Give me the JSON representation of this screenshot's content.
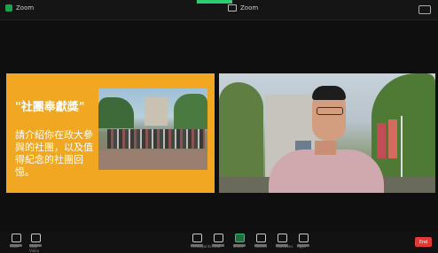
{
  "topbar": {
    "app_title": "Zoom",
    "window_label": "Zoom"
  },
  "slide": {
    "title": "\"社團奉獻獎\"",
    "body": "請介紹你在政大參與的社團，以及值得紀念的社團回憶。"
  },
  "toolbar": {
    "items": [
      {
        "label": "Mute"
      },
      {
        "label": "Stop Video"
      },
      {
        "label": "Participants"
      },
      {
        "label": "Chat"
      },
      {
        "label": "Share"
      },
      {
        "label": "Record"
      },
      {
        "label": "Reactions"
      },
      {
        "label": "Apps"
      }
    ],
    "end_label": "End"
  },
  "colors": {
    "slide_bg": "#f2a722",
    "end_button": "#e53935",
    "active_icon": "#31c46b"
  }
}
